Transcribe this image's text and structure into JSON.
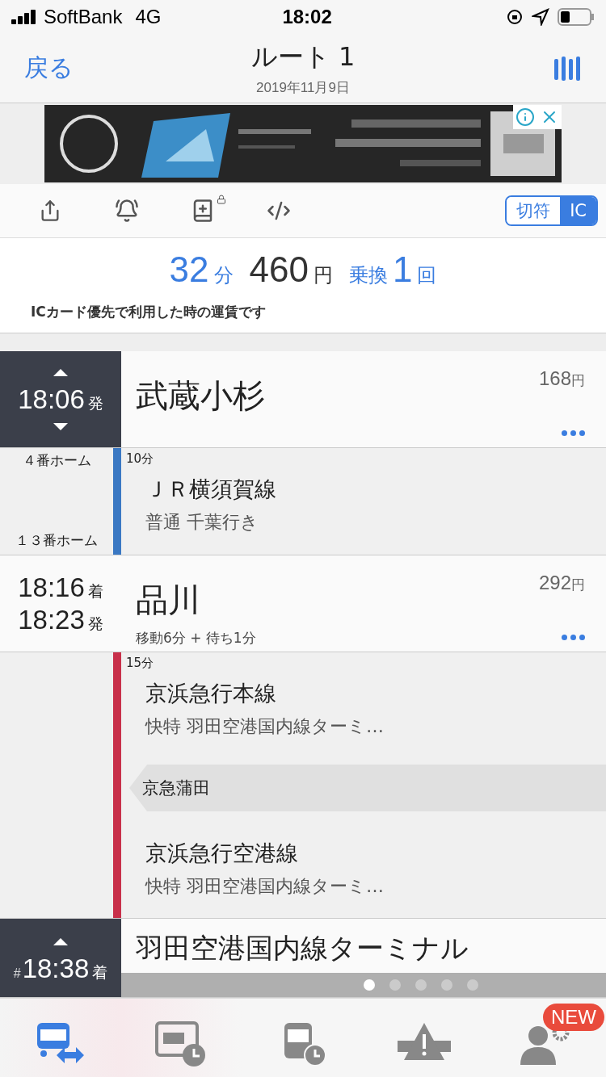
{
  "status_bar": {
    "carrier": "SoftBank",
    "network": "4G",
    "time": "18:02"
  },
  "nav": {
    "back": "戻る",
    "title": "ルート 1",
    "date": "2019年11月9日"
  },
  "fare_toggle": [
    {
      "label": "切符",
      "selected": false
    },
    {
      "label": "IC",
      "selected": true
    }
  ],
  "summary": {
    "minutes": "32",
    "minutes_unit": "分",
    "fare": "460",
    "fare_unit": "円",
    "transfer_label": "乗換",
    "transfers": "1",
    "transfers_unit": "回",
    "note": "ICカード優先で利用した時の運賃です"
  },
  "route": [
    {
      "kind": "stop",
      "boxed": true,
      "arrow_up": true,
      "arrow_down": true,
      "times": [
        {
          "time": "18:06",
          "suffix": "発"
        }
      ],
      "name": "武蔵小杉",
      "fare": "168",
      "fare_unit": "円",
      "more": true
    },
    {
      "kind": "segment",
      "color": "#3a78c3",
      "from_platform": "４番ホーム",
      "to_platform": "１３番ホーム",
      "duration": "10分",
      "items": [
        {
          "kind": "leg",
          "line": "ＪＲ横須賀線",
          "service": "普通 千葉行き"
        }
      ]
    },
    {
      "kind": "stop",
      "boxed": false,
      "arrow_up": false,
      "arrow_down": false,
      "times": [
        {
          "time": "18:16",
          "suffix": "着"
        },
        {
          "time": "18:23",
          "suffix": "発"
        }
      ],
      "name": "品川",
      "transfer_note": "移動6分 + 待ち1分",
      "fare": "292",
      "fare_unit": "円",
      "more": true
    },
    {
      "kind": "segment",
      "color": "#c8304a",
      "duration": "15分",
      "items": [
        {
          "kind": "leg",
          "line": "京浜急行本線",
          "service": "快特 羽田空港国内線ターミ…"
        },
        {
          "kind": "via",
          "name": "京急蒲田"
        },
        {
          "kind": "leg",
          "line": "京浜急行空港線",
          "service": "快特 羽田空港国内線ターミ…"
        }
      ]
    },
    {
      "kind": "stop",
      "boxed": true,
      "arrow_up": true,
      "arrow_down": false,
      "times": [
        {
          "mark": "#",
          "time": "18:38",
          "suffix": "着"
        }
      ],
      "name": "羽田空港国内線ターミナル",
      "more": false
    }
  ],
  "pager": [
    {
      "selected": true
    },
    {
      "selected": false
    },
    {
      "selected": false
    },
    {
      "selected": false
    },
    {
      "selected": false
    }
  ],
  "tabs": [
    {
      "kind": "route",
      "selected": true
    },
    {
      "kind": "timetable",
      "selected": false
    },
    {
      "kind": "bus",
      "selected": false
    },
    {
      "kind": "alert",
      "selected": false
    },
    {
      "kind": "account",
      "selected": false,
      "badge": "NEW"
    }
  ]
}
